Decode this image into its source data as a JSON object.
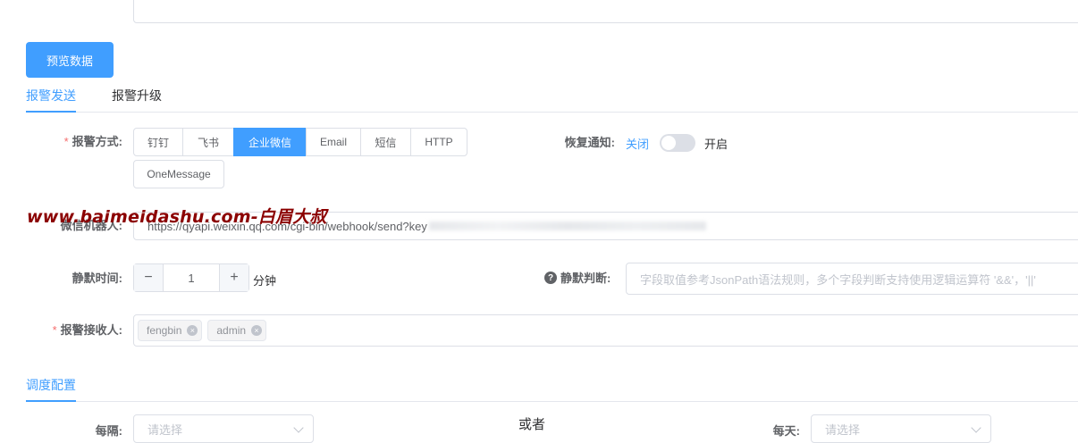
{
  "preview_button": "预览数据",
  "tabs": [
    {
      "label": "报警发送"
    },
    {
      "label": "报警升级"
    }
  ],
  "alert_method": {
    "label": "报警方式:",
    "required_mark": "*",
    "options": [
      "钉钉",
      "飞书",
      "企业微信",
      "Email",
      "短信",
      "HTTP"
    ],
    "extra_option": "OneMessage",
    "selected": "企业微信"
  },
  "recovery_notice": {
    "label": "恢复通知:",
    "off_label": "关闭",
    "on_label": "开启",
    "enabled": false
  },
  "watermark": "www.baimeidashu.com-白眉大叔",
  "wechat_robot": {
    "label": "微信机器人:",
    "value": "https://qyapi.weixin.qq.com/cgi-bin/webhook/send?key"
  },
  "silence_time": {
    "label": "静默时间:",
    "value": "1",
    "minus": "−",
    "plus": "+",
    "unit": "分钟"
  },
  "silence_judge": {
    "label": "静默判断:",
    "help": "?",
    "placeholder": "字段取值参考JsonPath语法规则，多个字段判断支持使用逻辑运算符 '&&'，'||'"
  },
  "receivers": {
    "label": "报警接收人:",
    "required_mark": "*",
    "tags": [
      "fengbin",
      "admin"
    ],
    "close_glyph": "×"
  },
  "schedule_tab": "调度配置",
  "schedule": {
    "every_label": "每隔:",
    "every_placeholder": "请选择",
    "or_text": "或者",
    "daily_label": "每天:",
    "daily_placeholder": "请选择"
  },
  "colors": {
    "primary": "#409eff",
    "required": "#f56c6c",
    "watermark": "#8b0000"
  }
}
